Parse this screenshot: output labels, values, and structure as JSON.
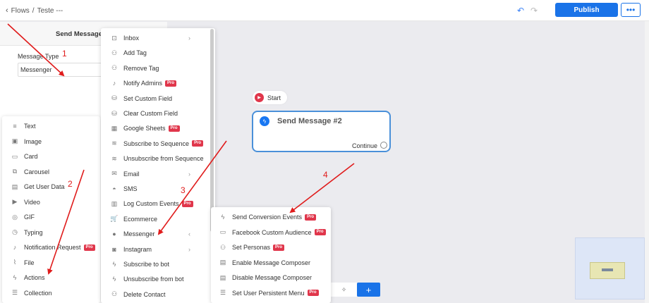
{
  "topbar": {
    "breadcrumb_flows": "Flows",
    "breadcrumb_sep": "/",
    "breadcrumb_current": "Teste ---",
    "publish_label": "Publish",
    "more_label": "•••"
  },
  "editor": {
    "title": "Send Message",
    "message_type_label": "Message Type",
    "message_type_value": "Messenger"
  },
  "left_menu": [
    {
      "icon": "text-icon",
      "label": "Text",
      "glyph": "≡"
    },
    {
      "icon": "image-icon",
      "label": "Image",
      "glyph": "▣"
    },
    {
      "icon": "card-icon",
      "label": "Card",
      "glyph": "▭"
    },
    {
      "icon": "carousel-icon",
      "label": "Carousel",
      "glyph": "⧉"
    },
    {
      "icon": "get-user-data-icon",
      "label": "Get User Data",
      "glyph": "▤"
    },
    {
      "icon": "video-icon",
      "label": "Video",
      "glyph": "▶"
    },
    {
      "icon": "gif-icon",
      "label": "GIF",
      "glyph": "◎"
    },
    {
      "icon": "typing-icon",
      "label": "Typing",
      "glyph": "◷"
    },
    {
      "icon": "notification-icon",
      "label": "Notification Request",
      "glyph": "♪",
      "pro": "Pro"
    },
    {
      "icon": "file-icon",
      "label": "File",
      "glyph": "⌇"
    },
    {
      "icon": "actions-icon",
      "label": "Actions",
      "glyph": "ϟ"
    },
    {
      "icon": "collection-icon",
      "label": "Collection",
      "glyph": "☰"
    }
  ],
  "mid_menu": [
    {
      "icon": "inbox-icon",
      "label": "Inbox",
      "glyph": "⊡",
      "arrow": "›"
    },
    {
      "icon": "add-tag-icon",
      "label": "Add Tag",
      "glyph": "⚇"
    },
    {
      "icon": "remove-tag-icon",
      "label": "Remove Tag",
      "glyph": "⚇"
    },
    {
      "icon": "bell-icon",
      "label": "Notify Admins",
      "glyph": "♪",
      "pro": "Pro"
    },
    {
      "icon": "database-icon",
      "label": "Set Custom Field",
      "glyph": "⛁"
    },
    {
      "icon": "database-icon",
      "label": "Clear Custom Field",
      "glyph": "⛁"
    },
    {
      "icon": "sheets-icon",
      "label": "Google Sheets",
      "glyph": "▦",
      "pro": "Pro"
    },
    {
      "icon": "sequence-icon",
      "label": "Subscribe to Sequence",
      "glyph": "≋",
      "pro": "Pro"
    },
    {
      "icon": "sequence-icon",
      "label": "Unsubscribe from Sequence",
      "glyph": "≋"
    },
    {
      "icon": "email-icon",
      "label": "Email",
      "glyph": "✉",
      "arrow": "›"
    },
    {
      "icon": "sms-icon",
      "label": "SMS",
      "glyph": "◓"
    },
    {
      "icon": "chart-icon",
      "label": "Log Custom Events",
      "glyph": "▥",
      "pro": "Pro"
    },
    {
      "icon": "ecommerce-icon",
      "label": "Ecommerce",
      "glyph": "🛒"
    },
    {
      "icon": "messenger-icon",
      "label": "Messenger",
      "glyph": "●",
      "arrow": "‹"
    },
    {
      "icon": "instagram-icon",
      "label": "Instagram",
      "glyph": "◙",
      "arrow": "›"
    },
    {
      "icon": "bolt-icon",
      "label": "Subscribe to bot",
      "glyph": "ϟ"
    },
    {
      "icon": "bolt-icon",
      "label": "Unsubscribe from bot",
      "glyph": "ϟ"
    },
    {
      "icon": "delete-contact-icon",
      "label": "Delete Contact",
      "glyph": "⚇"
    }
  ],
  "right_menu": [
    {
      "icon": "bolt-icon",
      "label": "Send Conversion Events",
      "glyph": "ϟ",
      "pro": "Pro"
    },
    {
      "icon": "audience-icon",
      "label": "Facebook Custom Audience",
      "glyph": "▭",
      "pro": "Pro"
    },
    {
      "icon": "persona-icon",
      "label": "Set Personas",
      "glyph": "⚇",
      "pro": "Pro"
    },
    {
      "icon": "keyboard-icon",
      "label": "Enable Message Composer",
      "glyph": "▤"
    },
    {
      "icon": "keyboard-icon",
      "label": "Disable Message Composer",
      "glyph": "▤"
    },
    {
      "icon": "menu-icon",
      "label": "Set User Persistent Menu",
      "glyph": "☰",
      "pro": "Pro"
    }
  ],
  "canvas": {
    "start_label": "Start",
    "node_title": "Send Message #2",
    "node_continue": "Continue",
    "add_label": "+"
  },
  "annotations": [
    "1",
    "2",
    "3",
    "4"
  ],
  "colors": {
    "accent": "#1a73e8",
    "pro": "#e0364b",
    "arrow": "#e01c1c"
  }
}
